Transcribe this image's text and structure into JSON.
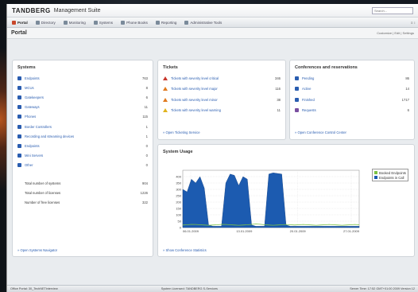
{
  "app": {
    "logo": "TANDBERG",
    "suite": "Management Suite",
    "search_placeholder": "Search..."
  },
  "nav": {
    "items": [
      {
        "label": "Portal",
        "icon": "portal-icon"
      },
      {
        "label": "Directory",
        "icon": "directory-icon"
      },
      {
        "label": "Monitoring",
        "icon": "monitoring-icon"
      },
      {
        "label": "Systems",
        "icon": "systems-icon"
      },
      {
        "label": "Phone Books",
        "icon": "phonebook-icon"
      },
      {
        "label": "Reporting",
        "icon": "reporting-icon"
      },
      {
        "label": "Administrative Tools",
        "icon": "tools-icon"
      }
    ],
    "right": "≡ ↕"
  },
  "page": {
    "title": "Portal",
    "right": "Customize | Edit | Settings"
  },
  "systems": {
    "title": "Systems",
    "items": [
      {
        "label": "Endpoints",
        "value": "763",
        "icon_color": "#2a5db0"
      },
      {
        "label": "MCUs",
        "value": "8",
        "icon_color": "#2a5db0"
      },
      {
        "label": "Gatekeepers",
        "value": "6",
        "icon_color": "#2a5db0"
      },
      {
        "label": "Gateways",
        "value": "11",
        "icon_color": "#2a5db0"
      },
      {
        "label": "Phones",
        "value": "115",
        "icon_color": "#2a5db0"
      },
      {
        "label": "Border Controllers",
        "value": "1",
        "icon_color": "#2a5db0"
      },
      {
        "label": "Recording and streaming devices",
        "value": "1",
        "icon_color": "#2a5db0"
      },
      {
        "label": "Endpoints",
        "value": "0",
        "icon_color": "#2a5db0"
      },
      {
        "label": "Mini Servers",
        "value": "0",
        "icon_color": "#2a5db0"
      },
      {
        "label": "Other",
        "value": "0",
        "icon_color": "#2a5db0"
      }
    ],
    "totals": [
      {
        "label": "Total number of systems",
        "value": "904"
      },
      {
        "label": "Total number of licenses",
        "value": "1226"
      },
      {
        "label": "Number of free licenses",
        "value": "322"
      }
    ],
    "link": "» Open Systems Navigator"
  },
  "tickets": {
    "title": "Tickets",
    "items": [
      {
        "label": "Tickets with severity level critical",
        "value": "346",
        "sev": "red"
      },
      {
        "label": "Tickets with severity level major",
        "value": "116",
        "sev": "orange"
      },
      {
        "label": "Tickets with severity level minor",
        "value": "38",
        "sev": "orange"
      },
      {
        "label": "Tickets with severity level warning",
        "value": "11",
        "sev": "yellow"
      }
    ],
    "link": "» Open Ticketing Service"
  },
  "conferences": {
    "title": "Conferences and reservations",
    "items": [
      {
        "label": "Pending",
        "value": "86"
      },
      {
        "label": "Active",
        "value": "14"
      },
      {
        "label": "Finished",
        "value": "1717"
      },
      {
        "label": "Requests",
        "value": "6"
      }
    ],
    "link": "» Open Conference Control Center"
  },
  "usage": {
    "title": "System Usage",
    "link": "» Show Conference Statistics"
  },
  "chart_data": {
    "type": "area",
    "title": "System Usage",
    "xlabel": "",
    "ylabel": "",
    "ylim": [
      0,
      450
    ],
    "yticks": [
      "0",
      "50",
      "100",
      "150",
      "200",
      "250",
      "300",
      "350",
      "400"
    ],
    "xticks": [
      "06.01.2009",
      "13.01.2009",
      "20.01.2009",
      "27.01.2009"
    ],
    "grid": true,
    "legend_position": "top-right",
    "series": [
      {
        "name": "Booked Endpoints",
        "color": "#7cc242",
        "values": [
          20,
          22,
          25,
          24,
          22,
          20,
          18,
          20,
          22,
          25,
          24,
          22,
          20,
          18,
          20,
          22,
          25,
          28,
          26,
          22,
          20,
          18,
          20,
          22,
          24,
          22,
          20,
          22,
          24,
          22,
          20,
          18,
          20,
          22,
          24,
          22,
          20,
          18,
          20,
          22,
          24,
          22
        ]
      },
      {
        "name": "Endpoints in Call",
        "color": "#1c5bb0",
        "values": [
          300,
          280,
          380,
          350,
          400,
          310,
          20,
          10,
          10,
          10,
          350,
          420,
          410,
          330,
          400,
          380,
          20,
          10,
          10,
          10,
          420,
          430,
          425,
          420,
          20,
          10,
          10,
          10,
          10,
          10,
          10,
          10,
          10,
          10,
          10,
          10,
          10,
          10,
          10,
          10,
          10,
          10
        ]
      }
    ]
  },
  "status": {
    "left": "Office Portal: 30_TechNETinterview",
    "mid": "System Licensed: TANDBERG S-Services",
    "right": "Server Time: 17:52   GMT+01:00 2009   Version 12"
  }
}
